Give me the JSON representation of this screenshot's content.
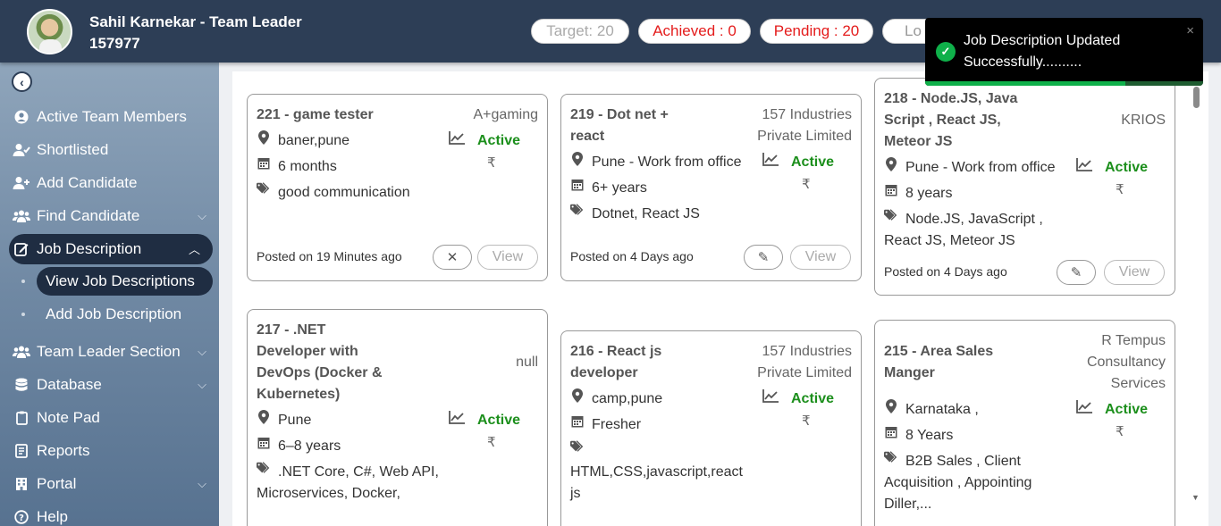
{
  "header": {
    "user_name": "Sahil Karnekar - Team Leader",
    "user_id": "157977",
    "target": "Target: 20",
    "achieved": "Achieved : 0",
    "pending": "Pending : 20",
    "logout": "Lo"
  },
  "sidebar": {
    "back_icon": "chevron-left-icon",
    "items": [
      {
        "label": "Active Team Members",
        "icon": "user-circle-icon"
      },
      {
        "label": "Shortlisted",
        "icon": "user-check-icon"
      },
      {
        "label": "Add Candidate",
        "icon": "user-plus-icon"
      },
      {
        "label": "Find Candidate",
        "icon": "users-icon"
      },
      {
        "label": "Job Description",
        "icon": "edit-icon"
      },
      {
        "label": "Team Leader Section",
        "icon": "users-icon"
      },
      {
        "label": "Database",
        "icon": "database-icon"
      },
      {
        "label": "Note Pad",
        "icon": "clipboard-icon"
      },
      {
        "label": "Reports",
        "icon": "report-icon"
      },
      {
        "label": "Portal",
        "icon": "building-icon"
      },
      {
        "label": "Help",
        "icon": "question-circle-icon"
      }
    ],
    "sub_items": [
      {
        "label": "View Job Descriptions"
      },
      {
        "label": "Add Job Description"
      }
    ]
  },
  "cards": [
    {
      "title": "221 - game tester",
      "company": "A+gaming",
      "location": "baner,pune",
      "experience": "6 months",
      "skills": "good communication",
      "status": "Active",
      "currency": "₹",
      "posted": "Posted on 19 Minutes ago",
      "view": "View"
    },
    {
      "title_l1": "219 - Dot net +",
      "title_l2": "react",
      "company_l1": "157 Industries",
      "company_l2": "Private Limited",
      "location": "Pune - Work from office",
      "experience": "6+ years",
      "skills": "Dotnet, React JS",
      "status": "Active",
      "currency": "₹",
      "posted": "Posted on 4 Days ago",
      "view": "View"
    },
    {
      "title_l1": "218 - Node.JS, Java",
      "title_l2": "Script , React JS,",
      "title_l3": "Meteor JS",
      "company": "KRIOS",
      "location": "Pune - Work from office",
      "experience": "8 years",
      "skills_l1": "Node.JS, JavaScript ,",
      "skills_l2": "React JS, Meteor JS",
      "status": "Active",
      "currency": "₹",
      "posted": "Posted on 4 Days ago",
      "view": "View"
    },
    {
      "title_l1": "217 - .NET",
      "title_l2": "Developer with",
      "title_l3": "DevOps (Docker &",
      "title_l4": "Kubernetes)",
      "company": "null",
      "location": "Pune",
      "experience": "6–8 years",
      "skills_l1": ".NET Core, C#, Web API,",
      "skills_l2": "Microservices, Docker,",
      "status": "Active",
      "currency": "₹"
    },
    {
      "title_l1": "216 - React js",
      "title_l2": "developer",
      "company_l1": "157 Industries",
      "company_l2": "Private Limited",
      "location": "camp,pune",
      "experience": "Fresher",
      "skills_l1": "HTML,CSS,javascript,react",
      "skills_l2": "js",
      "status": "Active",
      "currency": "₹"
    },
    {
      "title_l1": "215 - Area Sales",
      "title_l2": "Manger",
      "company_l1": "R Tempus",
      "company_l2": "Consultancy",
      "company_l3": "Services",
      "location": "Karnataka ,",
      "experience": "8 Years",
      "skills_l1": "B2B Sales , Client",
      "skills_l2": "Acquisition , Appointing",
      "skills_l3": "Diller,...",
      "status": "Active",
      "currency": "₹"
    }
  ],
  "toast": {
    "message_l1": "Job Description Updated",
    "message_l2": "Successfully..........",
    "progress": 0.72,
    "close": "×"
  }
}
